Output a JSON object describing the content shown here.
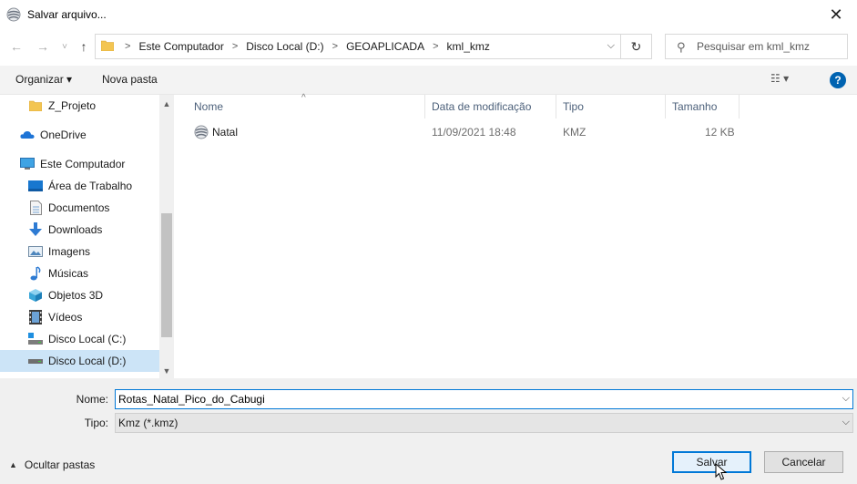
{
  "window": {
    "title": "Salvar arquivo...",
    "close_glyph": "✕",
    "app_icon": "google-earth-icon"
  },
  "nav": {
    "back_glyph": "←",
    "forward_glyph": "→",
    "recent_glyph": "˅",
    "up_glyph": "↑",
    "breadcrumb": [
      "Este Computador",
      "Disco Local (D:)",
      "GEOAPLICADA",
      "kml_kmz"
    ],
    "breadcrumb_sep": ">",
    "dropdown_glyph": "⌵",
    "refresh_glyph": "↻",
    "search_placeholder": "Pesquisar em kml_kmz",
    "search_glyph": "⚲"
  },
  "toolbar": {
    "organize": "Organizar ▾",
    "new_folder": "Nova pasta",
    "view_glyph": "☷ ▾",
    "help_glyph": "?"
  },
  "sidebar": {
    "items": [
      {
        "label": "Z_Projeto",
        "icon": "folder-icon"
      },
      {
        "label": "OneDrive",
        "icon": "onedrive-icon"
      },
      {
        "label": "Este Computador",
        "icon": "computer-icon"
      },
      {
        "label": "Área de Trabalho",
        "icon": "desktop-icon"
      },
      {
        "label": "Documentos",
        "icon": "documents-icon"
      },
      {
        "label": "Downloads",
        "icon": "downloads-icon"
      },
      {
        "label": "Imagens",
        "icon": "pictures-icon"
      },
      {
        "label": "Músicas",
        "icon": "music-icon"
      },
      {
        "label": "Objetos 3D",
        "icon": "3d-objects-icon"
      },
      {
        "label": "Vídeos",
        "icon": "videos-icon"
      },
      {
        "label": "Disco Local (C:)",
        "icon": "drive-c-icon"
      },
      {
        "label": "Disco Local (D:)",
        "icon": "drive-d-icon",
        "selected": true
      }
    ],
    "scroll_up_glyph": "▲",
    "scroll_down_glyph": "▼"
  },
  "filelist": {
    "columns": {
      "name": "Nome",
      "date": "Data de modificação",
      "type": "Tipo",
      "size": "Tamanho"
    },
    "sort_glyph": "^",
    "files": [
      {
        "name": "Natal",
        "date": "11/09/2021 18:48",
        "type": "KMZ",
        "size": "12 KB",
        "icon": "kmz-file-icon"
      }
    ]
  },
  "form": {
    "name_label": "Nome:",
    "name_value": "Rotas_Natal_Pico_do_Cabugi",
    "type_label": "Tipo:",
    "type_value": "Kmz (*.kmz)",
    "dropdown_glyph": "⌵",
    "hide_folders": "Ocultar pastas",
    "hide_glyph": "▲",
    "save": "Salvar",
    "cancel": "Cancelar"
  },
  "colors": {
    "accent": "#0078d7",
    "selection": "#cce4f7",
    "toolbar_bg": "#f3f3f3",
    "footer_bg": "#f0f0f0"
  }
}
